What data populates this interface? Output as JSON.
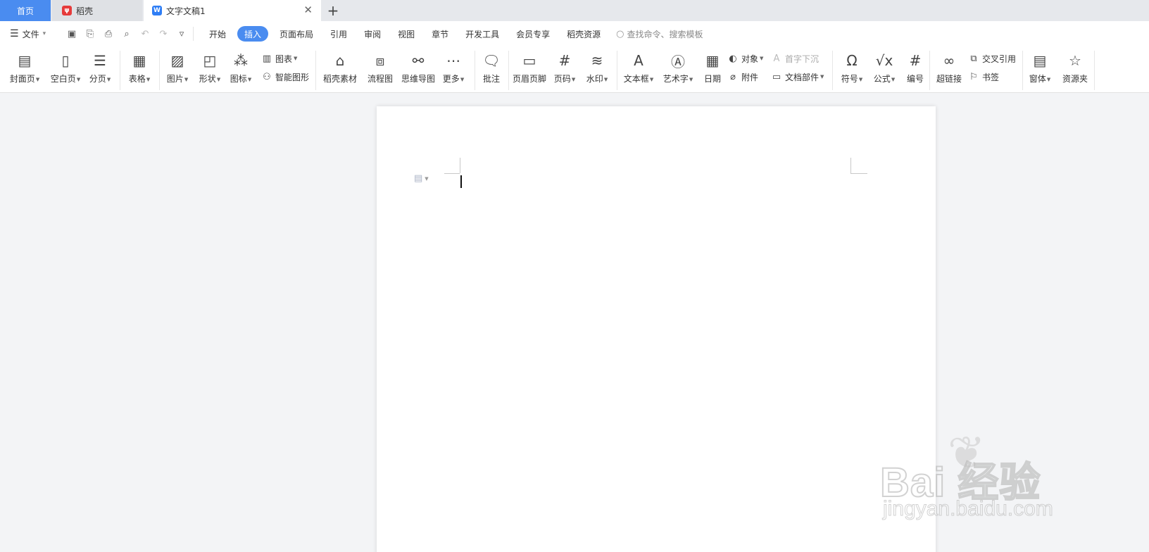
{
  "tabs": {
    "home": "首页",
    "daoke": "稻壳",
    "document": "文字文稿1",
    "close": "✕",
    "add": "+"
  },
  "menu": {
    "file": "文件",
    "items": [
      "开始",
      "插入",
      "页面布局",
      "引用",
      "审阅",
      "视图",
      "章节",
      "开发工具",
      "会员专享",
      "稻壳资源"
    ],
    "active_index": 1,
    "search_placeholder": "查找命令、搜索模板"
  },
  "ribbon": {
    "cover_page": "封面页",
    "blank_page": "空白页",
    "page_break": "分页",
    "table": "表格",
    "picture": "图片",
    "shape": "形状",
    "icons": "图标",
    "chart": "图表",
    "smart_art": "智能图形",
    "daoke_material": "稻壳素材",
    "flowchart": "流程图",
    "mind_map": "思维导图",
    "more": "更多",
    "comment": "批注",
    "header_footer": "页眉页脚",
    "page_number": "页码",
    "watermark": "水印",
    "text_box": "文本框",
    "word_art": "艺术字",
    "date": "日期",
    "object": "对象",
    "attachment": "附件",
    "drop_cap": "首字下沉",
    "doc_parts": "文档部件",
    "symbol": "符号",
    "formula": "公式",
    "numbering": "编号",
    "hyperlink": "超链接",
    "cross_ref": "交叉引用",
    "bookmark": "书签",
    "window": "窗体",
    "resource": "资源夹"
  },
  "watermark_overlay": {
    "brand": "Bai  经验",
    "url": "jingyan.baidu.com"
  },
  "colors": {
    "accent": "#4a8cf0",
    "tab_bar": "#e6e8ec",
    "workspace": "#f3f4f6"
  }
}
